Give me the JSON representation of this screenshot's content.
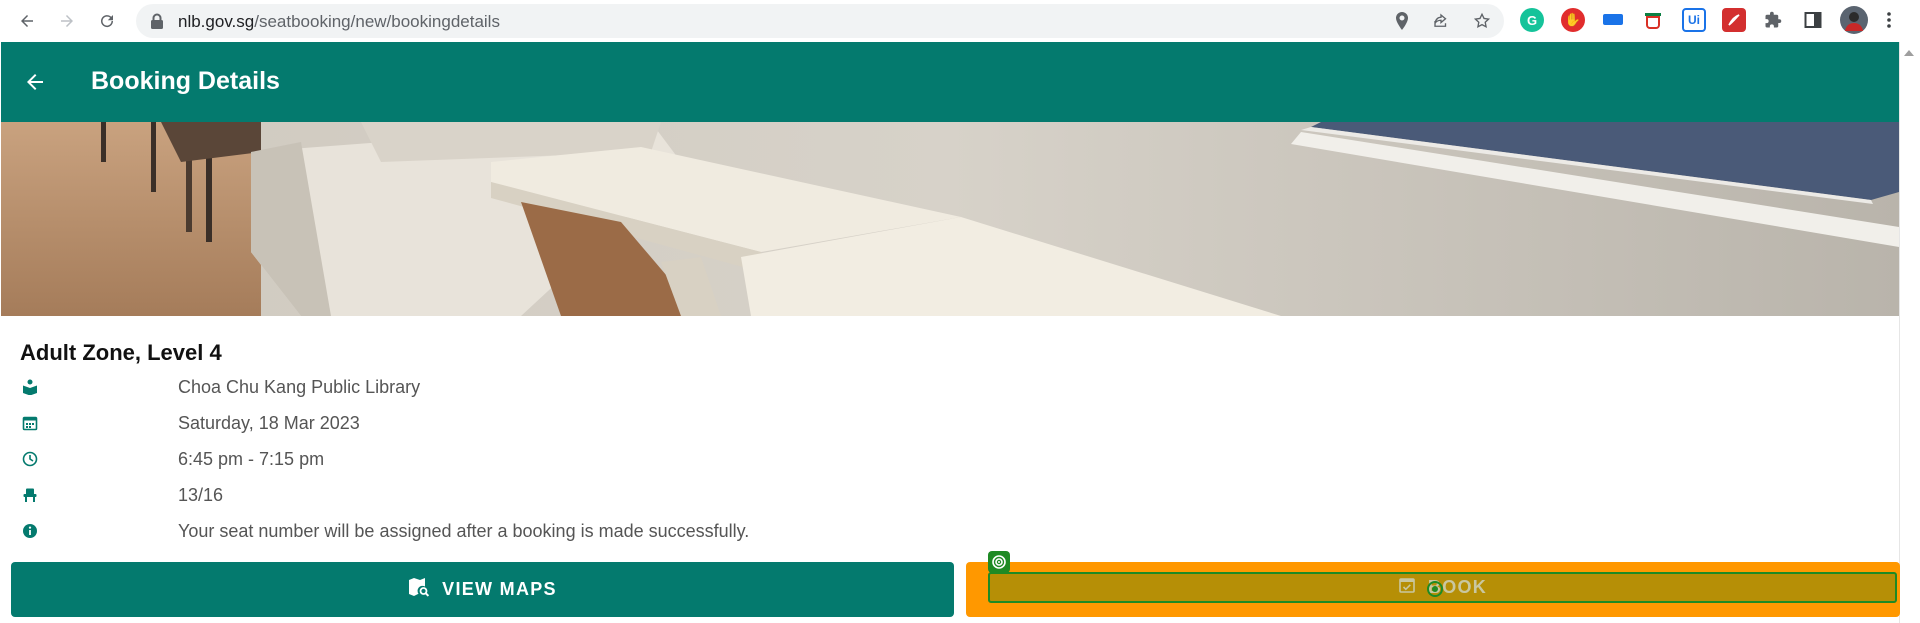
{
  "browser": {
    "url_host": "nlb.gov.sg",
    "url_path": "/seatbooking/new/bookingdetails"
  },
  "app_bar": {
    "title": "Booking Details"
  },
  "venue": {
    "zone_title": "Adult Zone, Level 4",
    "details": [
      {
        "icon": "book-reader-icon",
        "text": "Choa Chu Kang Public Library"
      },
      {
        "icon": "calendar-icon",
        "text": "Saturday, 18 Mar 2023"
      },
      {
        "icon": "clock-icon",
        "text": "6:45 pm - 7:15 pm"
      },
      {
        "icon": "seat-icon",
        "text": "13/16"
      },
      {
        "icon": "info-icon",
        "text": "Your seat number will be assigned after a booking is made successfully."
      }
    ]
  },
  "actions": {
    "view_maps_label": "VIEW MAPS",
    "book_label": "BOOK"
  },
  "colors": {
    "primary": "#047a6e",
    "book_highlight": "#ff9800",
    "overlay": "#b68f06",
    "overlay_border": "#1e8a24"
  }
}
